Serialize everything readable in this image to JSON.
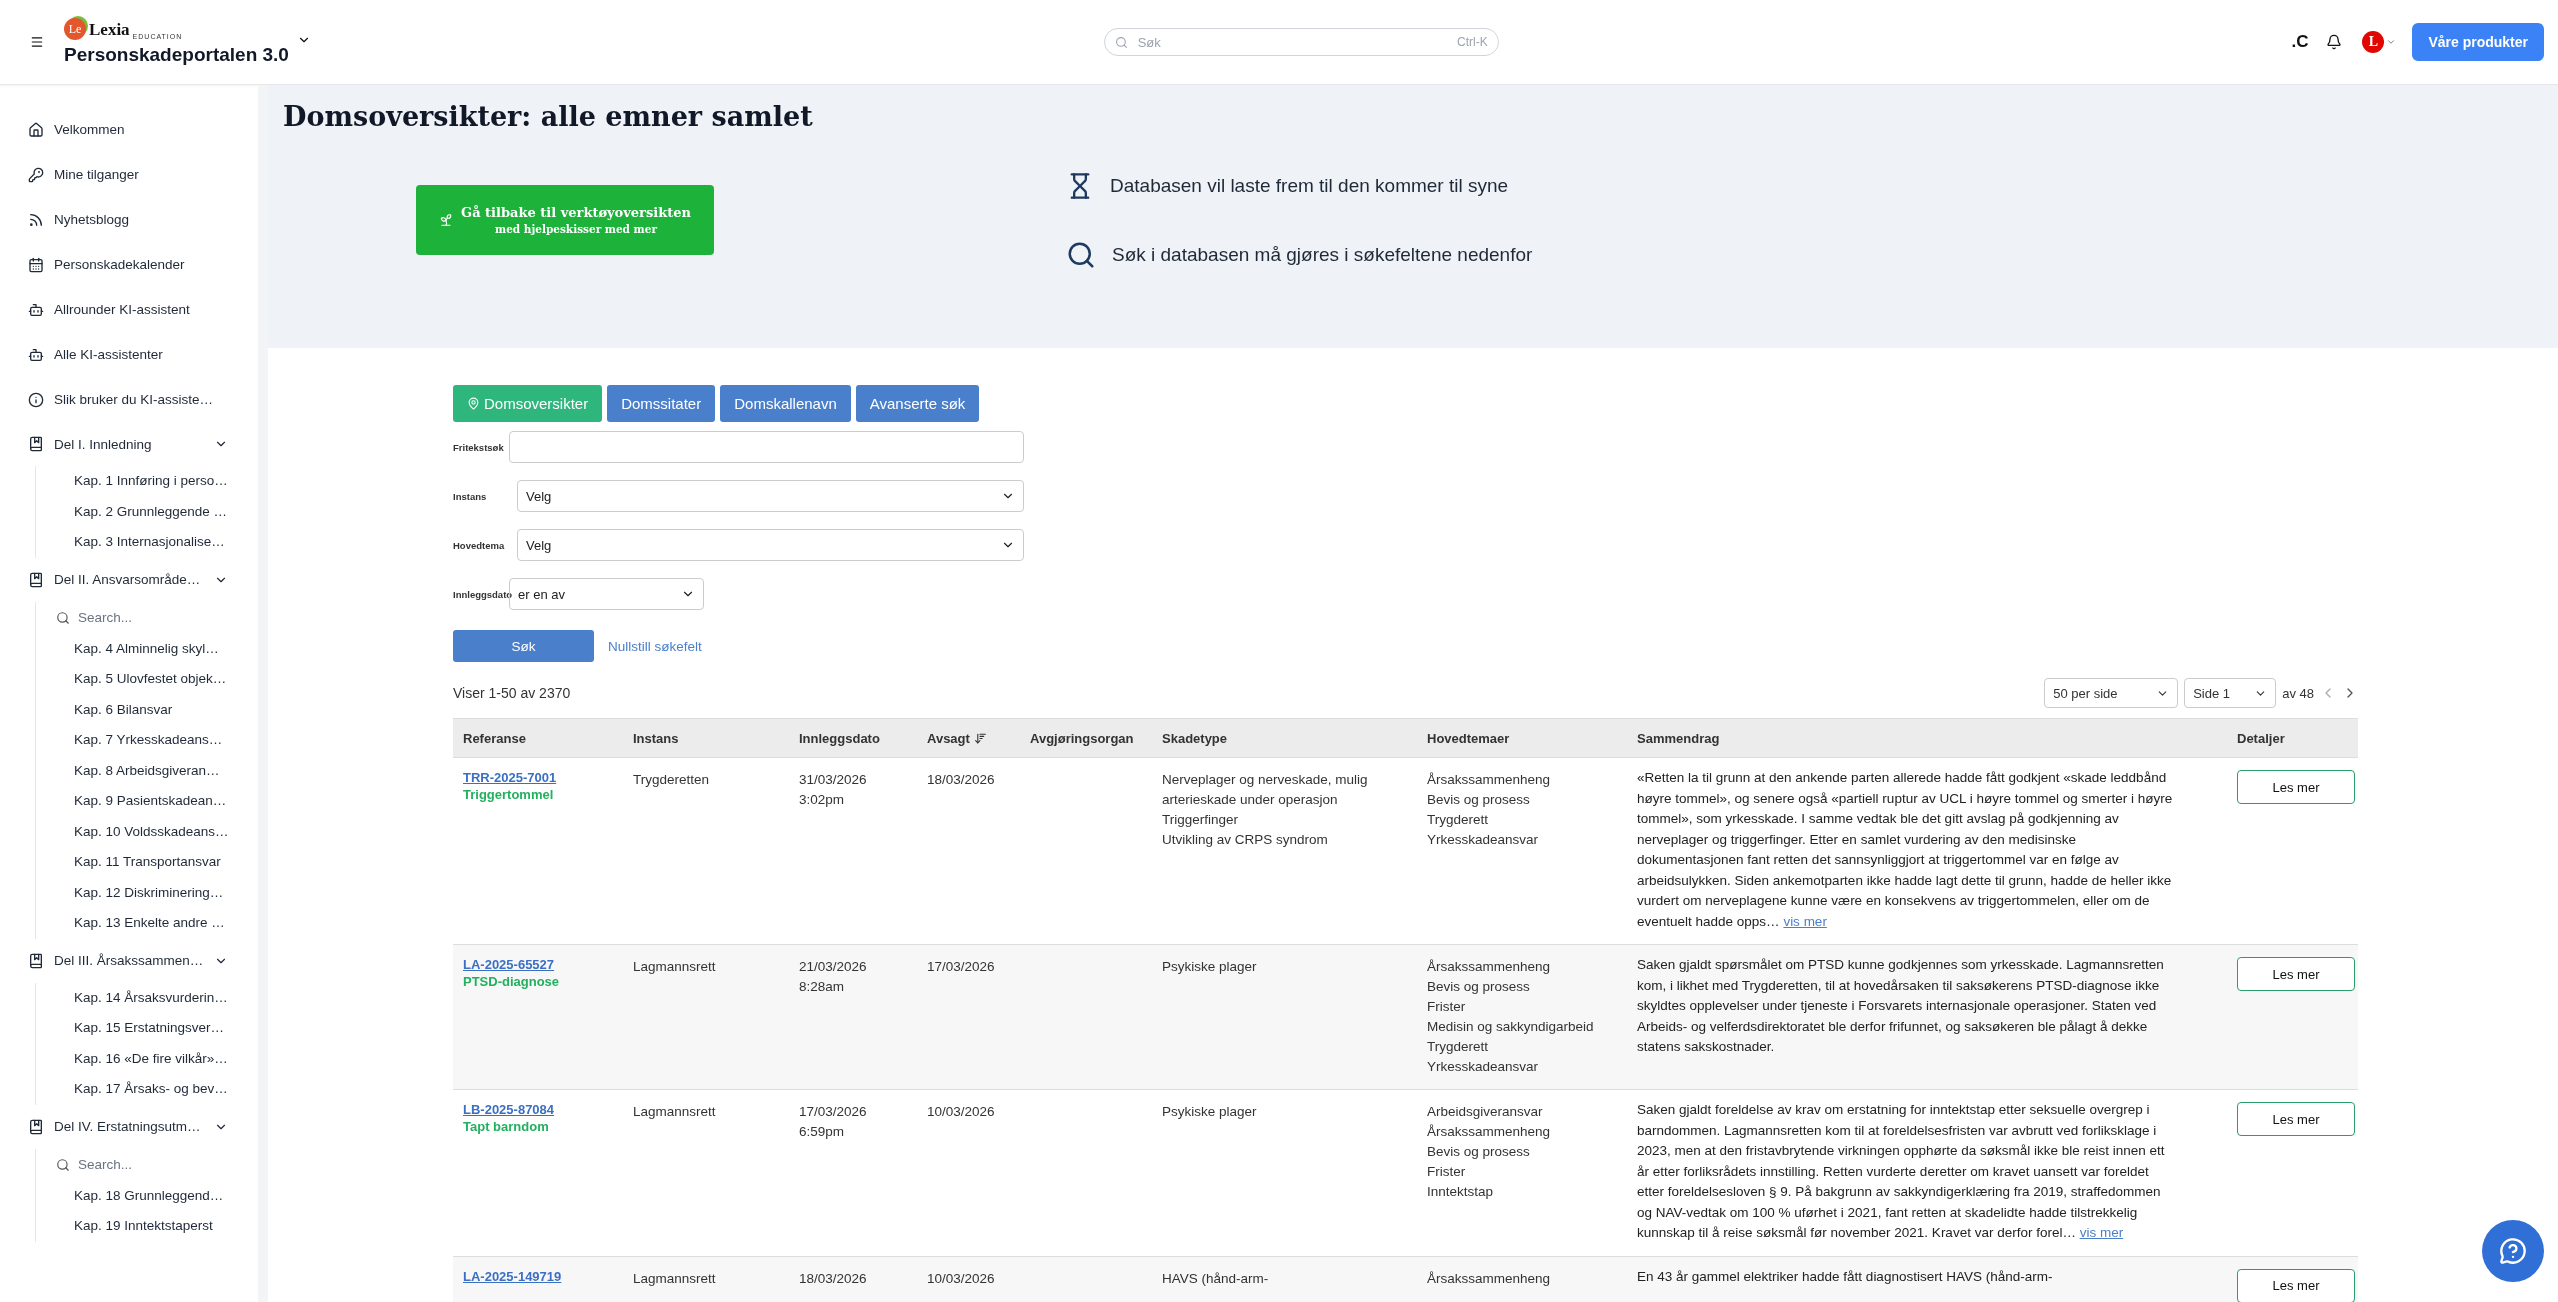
{
  "header": {
    "logo": {
      "mark": "Le",
      "name": "Lexia",
      "tagline": "EDUCATION"
    },
    "app_title": "Personskadeportalen 3.0",
    "search": {
      "placeholder": "Søk",
      "shortcut": "Ctrl-K"
    },
    "c_badge": ".C",
    "avatar": {
      "letter": "L"
    },
    "products_button": "Våre produkter"
  },
  "sidebar": {
    "items": [
      {
        "kind": "link",
        "label": "Velkommen"
      },
      {
        "kind": "link",
        "label": "Mine tilganger"
      },
      {
        "kind": "link",
        "label": "Nyhetsblogg"
      },
      {
        "kind": "link",
        "label": "Personskadekalender"
      },
      {
        "kind": "link",
        "label": "Allrounder KI-assistent"
      },
      {
        "kind": "link",
        "label": "Alle KI-assistenter"
      },
      {
        "kind": "link",
        "label": "Slik bruker du KI-assiste…"
      },
      {
        "kind": "section",
        "label": "Del I. Innledning",
        "expanded": true,
        "children": [
          {
            "kind": "link",
            "label": "Kap. 1 Innføring i perso…"
          },
          {
            "kind": "link",
            "label": "Kap. 2 Grunnleggende …"
          },
          {
            "kind": "link",
            "label": "Kap. 3 Internasjonalise…"
          }
        ]
      },
      {
        "kind": "section",
        "label": "Del II. Ansvarsområde…",
        "expanded": true,
        "children": [
          {
            "kind": "search",
            "placeholder": "Search..."
          },
          {
            "kind": "link",
            "label": "Kap. 4 Alminnelig skyl…"
          },
          {
            "kind": "link",
            "label": "Kap. 5 Ulovfestet objek…"
          },
          {
            "kind": "link",
            "label": "Kap. 6 Bilansvar"
          },
          {
            "kind": "link",
            "label": "Kap. 7 Yrkesskadeans…"
          },
          {
            "kind": "link",
            "label": "Kap. 8 Arbeidsgiveran…"
          },
          {
            "kind": "link",
            "label": "Kap. 9 Pasientskadean…"
          },
          {
            "kind": "link",
            "label": "Kap. 10 Voldsskadeans…"
          },
          {
            "kind": "link",
            "label": "Kap. 11 Transportansvar"
          },
          {
            "kind": "link",
            "label": "Kap. 12 Diskriminering…"
          },
          {
            "kind": "link",
            "label": "Kap. 13 Enkelte andre …"
          }
        ]
      },
      {
        "kind": "section",
        "label": "Del III. Årsakssammen…",
        "expanded": true,
        "children": [
          {
            "kind": "link",
            "label": "Kap. 14 Årsaksvurderin…"
          },
          {
            "kind": "link",
            "label": "Kap. 15 Erstatningsver…"
          },
          {
            "kind": "link",
            "label": "Kap. 16 «De fire vilkår»…"
          },
          {
            "kind": "link",
            "label": "Kap. 17 Årsaks- og bev…"
          }
        ]
      },
      {
        "kind": "section",
        "label": "Del IV. Erstatningsutm…",
        "expanded": true,
        "children": [
          {
            "kind": "search",
            "placeholder": "Search..."
          },
          {
            "kind": "link",
            "label": "Kap. 18 Grunnleggend…"
          },
          {
            "kind": "link",
            "label": "Kap. 19 Inntektstaperst"
          }
        ]
      }
    ]
  },
  "hero": {
    "title": "Domsoversikter: alle emner samlet",
    "back_button": {
      "line1": "Gå tilbake til verktøyoversikten",
      "line2": "med hjelpeskisser med mer"
    },
    "notes": [
      "Databasen vil laste frem til den kommer til syne",
      "Søk i databasen må gjøres i søkefeltene nedenfor"
    ]
  },
  "tabs": [
    {
      "label": "Domsoversikter",
      "selected": true
    },
    {
      "label": "Domssitater",
      "selected": false
    },
    {
      "label": "Domskallenavn",
      "selected": false
    },
    {
      "label": "Avanserte søk",
      "selected": false
    }
  ],
  "form": {
    "fields": [
      {
        "label": "Fritekstsøk",
        "kind": "text"
      },
      {
        "label": "Instans",
        "kind": "select",
        "value": "Velg"
      },
      {
        "label": "Hovedtema",
        "kind": "select",
        "value": "Velg"
      },
      {
        "label": "Innleggsdato",
        "kind": "short-select",
        "value": "er en av"
      }
    ],
    "search_button": "Søk",
    "reset_link": "Nullstill søkefelt"
  },
  "results": {
    "count": "Viser 1-50 av 2370",
    "per_page": "50 per side",
    "page": "Side 1",
    "page_total": "av 48"
  },
  "table": {
    "columns": [
      {
        "label": "Referanse",
        "sorted": false
      },
      {
        "label": "Instans",
        "sorted": false
      },
      {
        "label": "Innleggsdato",
        "sorted": false
      },
      {
        "label": "Avsagt",
        "sorted": true
      },
      {
        "label": "Avgjøringsorgan",
        "sorted": false
      },
      {
        "label": "Skadetype",
        "sorted": false
      },
      {
        "label": "Hovedtemaer",
        "sorted": false
      },
      {
        "label": "Sammendrag",
        "sorted": false
      },
      {
        "label": "Detaljer",
        "sorted": false
      }
    ],
    "rows": [
      {
        "reference": "TRR-2025-7001",
        "tag": "Triggertommel",
        "instans": "Trygderetten",
        "filed": [
          "31/03/2026",
          "3:02pm"
        ],
        "decided": "18/03/2026",
        "injury_types": [
          "Nerveplager og nerveskade, mulig arterieskade under operasjon",
          "Triggerfinger",
          "Utvikling av CRPS syndrom"
        ],
        "themes": [
          "Årsakssammenheng",
          "Bevis og prosess",
          "Trygderett",
          "Yrkesskadeansvar"
        ],
        "summary": "«Retten la til grunn at den ankende parten allerede hadde fått godkjent «skade leddbånd høyre tommel», og senere også «partiell ruptur av UCL i høyre tommel og smerter i høyre tommel», som yrkesskade. I samme vedtak ble det gitt avslag på godkjenning av nerveplager og triggerfinger. Etter en samlet vurdering av den medisinske dokumentasjonen fant retten det sannsynliggjort at triggertommel var en følge av arbeidsulykken. Siden ankemotparten ikke hadde lagt dette til grunn, hadde de heller ikke vurdert om nerveplagene kunne være en konsekvens av triggertommelen, eller om de eventuelt hadde opps…",
        "more_link": "vis mer",
        "button": "Les mer"
      },
      {
        "reference": "LA-2025-65527",
        "tag": "PTSD-diagnose",
        "instans": "Lagmannsrett",
        "filed": [
          "21/03/2026",
          "8:28am"
        ],
        "decided": "17/03/2026",
        "injury_types": [
          "Psykiske plager"
        ],
        "themes": [
          "Årsakssammenheng",
          "Bevis og prosess",
          "Frister",
          "Medisin og sakkyndigarbeid",
          "Trygderett",
          "Yrkesskadeansvar"
        ],
        "summary": "Saken gjaldt spørsmålet om PTSD kunne godkjennes som yrkesskade. Lagmannsretten kom, i likhet med Trygderetten, til at hovedårsaken til saksøkerens PTSD-diagnose ikke skyldtes opplevelser under tjeneste i Forsvarets internasjonale operasjoner. Staten ved Arbeids- og velferdsdirektoratet ble derfor frifunnet, og saksøkeren ble pålagt å dekke statens sakskostnader.",
        "button": "Les mer"
      },
      {
        "reference": "LB-2025-87084",
        "tag": "Tapt barndom",
        "instans": "Lagmannsrett",
        "filed": [
          "17/03/2026",
          "6:59pm"
        ],
        "decided": "10/03/2026",
        "injury_types": [
          "Psykiske plager"
        ],
        "themes": [
          "Arbeidsgiveransvar",
          "Årsakssammenheng",
          "Bevis og prosess",
          "Frister",
          "Inntektstap"
        ],
        "summary": "Saken gjaldt foreldelse av krav om erstatning for inntektstap etter seksuelle overgrep i barndommen. Lagmannsretten kom til at foreldelsesfristen var avbrutt ved forliksklage i 2023, men at den fristavbrytende virkningen opphørte da søksmål ikke ble reist innen ett år etter forliksrådets innstilling. Retten vurderte deretter om kravet uansett var foreldet etter foreldelsesloven § 9. På bakgrunn av sakkyndigerklæring fra 2019, straffedommen og NAV-vedtak om 100 % uførhet i 2021, fant retten at skadelidte hadde tilstrekkelig kunnskap til å reise søksmål før november 2021. Kravet var derfor forel…",
        "more_link": "vis mer",
        "button": "Les mer"
      },
      {
        "reference": "LA-2025-149719",
        "instans": "Lagmannsrett",
        "filed": [
          "18/03/2026"
        ],
        "decided": "10/03/2026",
        "injury_types": [
          "HAVS (hånd-arm-"
        ],
        "themes": [
          "Årsakssammenheng"
        ],
        "summary": "En 43 år gammel elektriker hadde fått diagnostisert HAVS (hånd-arm-",
        "button": "Les mer"
      }
    ]
  }
}
